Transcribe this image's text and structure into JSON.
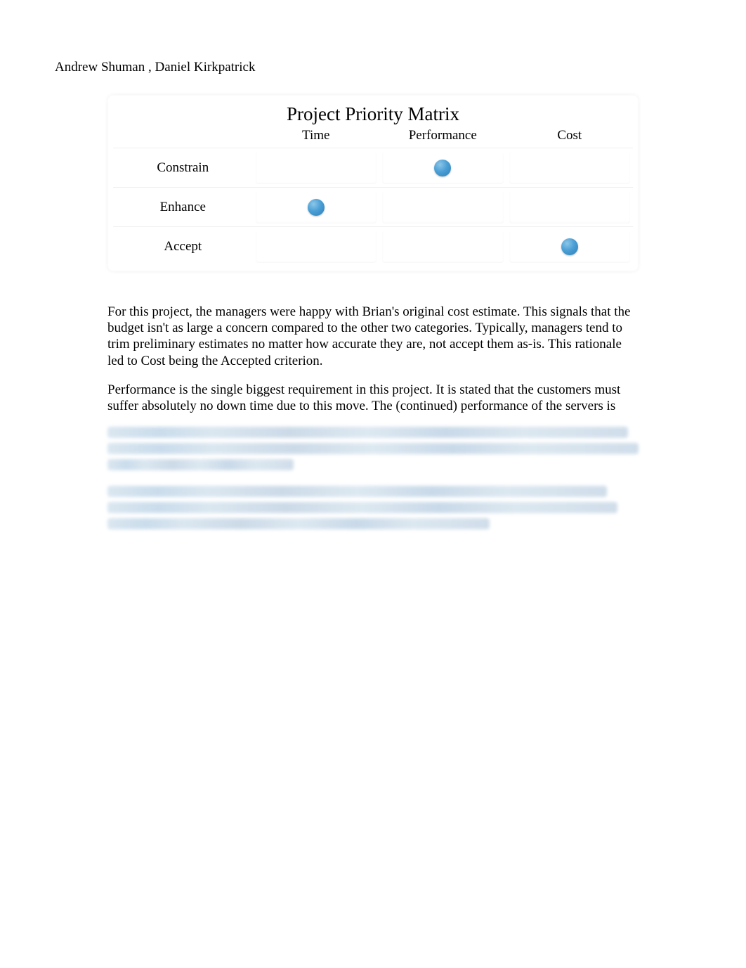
{
  "authors": "Andrew Shuman , Daniel Kirkpatrick",
  "matrix": {
    "title": "Project Priority Matrix",
    "columns": [
      "Time",
      "Performance",
      "Cost"
    ],
    "rows": [
      {
        "label": "Constrain",
        "marks": [
          false,
          true,
          false
        ]
      },
      {
        "label": "Enhance",
        "marks": [
          true,
          false,
          false
        ]
      },
      {
        "label": "Accept",
        "marks": [
          false,
          false,
          true
        ]
      }
    ]
  },
  "paragraphs": [
    "For this project, the managers were happy with Brian's original cost estimate. This signals that the budget isn't as large a concern compared to the other two categories. Typically, managers tend to trim preliminary estimates no matter how accurate they are, not accept them as-is. This rationale led to Cost being the Accepted criterion.",
    "Performance is the single biggest requirement in this project. It is stated that the customers must suffer absolutely no down time due to this move. The (continued) performance of the servers is"
  ]
}
